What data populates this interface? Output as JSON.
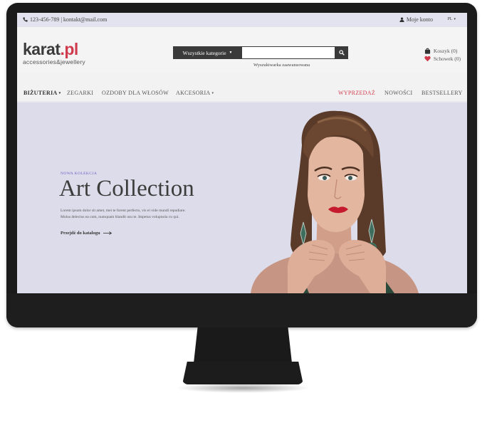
{
  "topbar": {
    "contact": "123-456-789 | kontakt@mail.com",
    "account": "Moje konto",
    "language": "PL"
  },
  "header": {
    "logo_main": "karat",
    "logo_accent": ".pl",
    "logo_sub": "accessories&jewellery",
    "search_category": "Wszystkie kategorie",
    "search_value": "",
    "search_advanced": "Wyszukiwarka zaawansowana",
    "cart": "Koszyk (0)",
    "wishlist": "Schowek (0)"
  },
  "nav": {
    "left": [
      "BIŻUTERIA",
      "ZEGARKI",
      "OZDOBY DLA WŁOSÓW",
      "AKCESORIA"
    ],
    "right": [
      "WYPRZEDAŻ",
      "NOWOŚCI",
      "BESTSELLERY"
    ]
  },
  "hero": {
    "tag": "NOWA KOLEKCJA",
    "title": "Art Collection",
    "desc_line1": "Lorem ipsum dolor sit amet, mei te forent perfecto, vis ei vide mundi repudiare.",
    "desc_line2": "Molus delectus ea cum, numquam blandit usu te. Impetus voluptaria cu qui.",
    "cta": "Przejdź do katalogu"
  },
  "colors": {
    "accent": "#d03a4d",
    "topbar_bg": "#e3e3ef",
    "hero_bg": "#dcdcea",
    "dark": "#3a3a3a",
    "tag": "#6d63c9"
  }
}
